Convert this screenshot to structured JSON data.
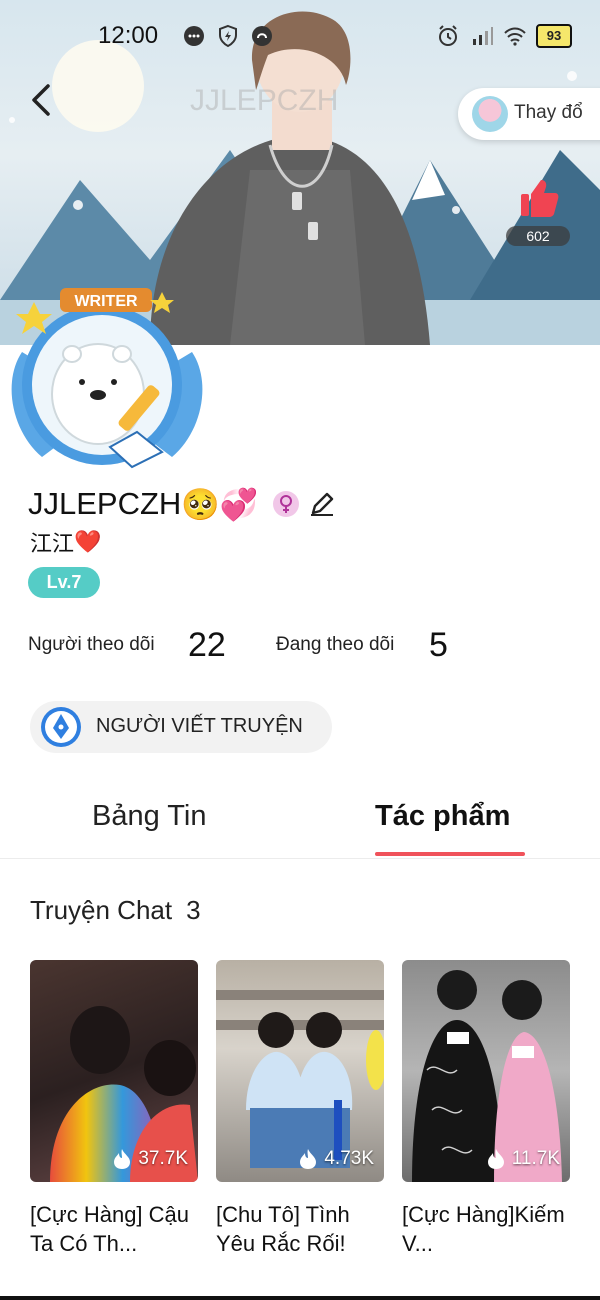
{
  "status_bar": {
    "time": "12:00",
    "battery": "93"
  },
  "header": {
    "watermark_name": "JJLEPCZH",
    "change_button_label": "Thay đổ",
    "like_count": "602"
  },
  "avatar": {
    "frame_label": "WRITER"
  },
  "profile": {
    "username": "JJLEPCZH",
    "username_emojis": "🥺💞",
    "subtitle": "江江",
    "subtitle_emoji": "❤️",
    "level": "Lv.7",
    "followers_label": "Người theo dõi",
    "followers_value": "22",
    "following_label": "Đang theo dõi",
    "following_value": "5",
    "role_label": "NGƯỜI VIẾT TRUYỆN"
  },
  "tabs": [
    {
      "label": "Bảng Tin",
      "active": false
    },
    {
      "label": "Tác phẩm",
      "active": true
    }
  ],
  "section": {
    "title": "Truyện Chat",
    "count": "3"
  },
  "stories": [
    {
      "views": "37.7K",
      "title": "[Cực Hàng] Cậu Ta Có Th..."
    },
    {
      "views": "4.73K",
      "title": "[Chu Tô] Tình Yêu Rắc Rối!"
    },
    {
      "views": "11.7K",
      "title": "[Cực Hàng]Kiếm V..."
    }
  ],
  "colors": {
    "accent_red": "#f0525a",
    "level_badge": "#55ccc6",
    "like_red": "#f04452"
  }
}
